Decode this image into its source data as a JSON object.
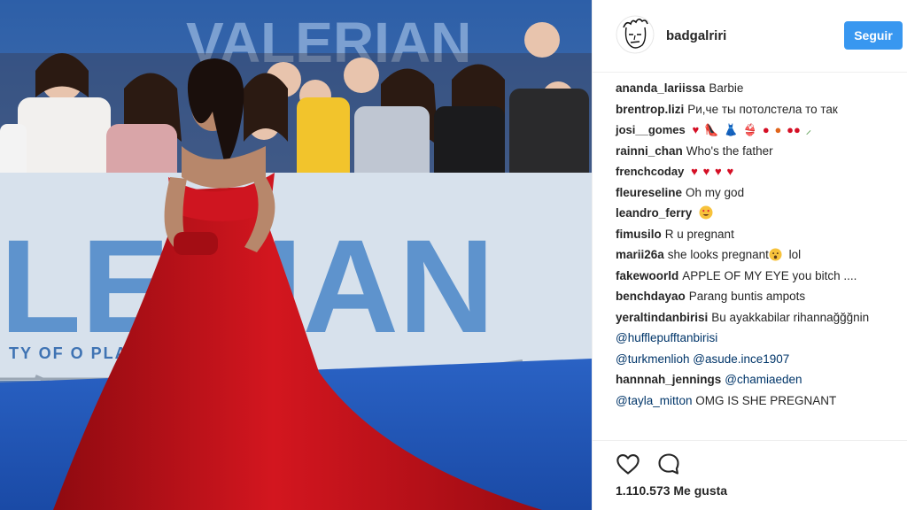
{
  "post": {
    "author": "badgalriri",
    "follow_label": "Seguir",
    "likes_text": "1.110.573 Me gusta",
    "backdrop_text_line": "TY   OF           O PLANETS",
    "backdrop_title_left": "VALERIAN",
    "backdrop_title_big": "LERIAN"
  },
  "comments": [
    {
      "user": "ananda_lariissa",
      "text": "Barbie"
    },
    {
      "user": "brentrop.lizi",
      "text": "Ри,че ты потолстела то так"
    },
    {
      "user": "josi__gomes",
      "text": "",
      "emoji": [
        "heart-emoji",
        "high-heel-emoji",
        "dress-emoji",
        "bikini-emoji",
        "tomato-emoji",
        "peach-emoji",
        "cherries-emoji",
        "pepper-emoji"
      ]
    },
    {
      "user": "rainni_chan",
      "text": "Who's the father"
    },
    {
      "user": "frenchcoday",
      "text": "",
      "emoji": [
        "heart-emoji",
        "heart-emoji",
        "heart-emoji",
        "heart-emoji"
      ]
    },
    {
      "user": "fleureseline",
      "text": "Oh my god"
    },
    {
      "user": "leandro_ferry",
      "text": "",
      "emoji": [
        "heart-eyes-emoji"
      ]
    },
    {
      "user": "fimusilo",
      "text": "R u pregnant"
    },
    {
      "user": "marii26a",
      "text": "she looks pregnant",
      "text_after": "lol",
      "emoji": [
        "surprised-face-emoji"
      ]
    },
    {
      "user": "fakewoorld",
      "text": "APPLE OF MY EYE you bitch ...."
    },
    {
      "user": "benchdayao",
      "text": "Parang buntis ampots"
    },
    {
      "user": "yeraltindanbirisi",
      "text": "Bu ayakkabilar rihannağğğnin",
      "mentions": [
        "@hufflepufftanbirisi",
        "@turkmenlioh",
        "@asude.ince1907"
      ]
    },
    {
      "user": "hannnah_jennings",
      "mentions_first": "@chamiaeden",
      "mentions": [
        "@tayla_mitton"
      ],
      "text": "OMG IS SHE PREGNANT"
    }
  ],
  "colors": {
    "follow_button": "#3897f0",
    "mention": "#003569",
    "dress": "#c4121a",
    "carpet": "#1f4fa8"
  }
}
